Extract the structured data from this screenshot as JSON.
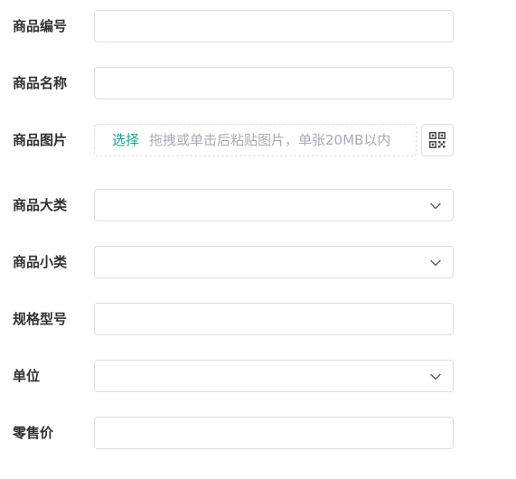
{
  "form": {
    "fields": [
      {
        "label": "商品编号",
        "type": "text",
        "value": ""
      },
      {
        "label": "商品名称",
        "type": "text",
        "value": ""
      },
      {
        "label": "商品图片",
        "type": "upload",
        "choose_label": "选择",
        "hint": "拖拽或单击后粘贴图片，单张20MB以内",
        "side_button_icon": "qr-code-icon"
      },
      {
        "label": "商品大类",
        "type": "select",
        "value": "",
        "icon": "chevron-down-icon"
      },
      {
        "label": "商品小类",
        "type": "select",
        "value": "",
        "icon": "chevron-down-icon"
      },
      {
        "label": "规格型号",
        "type": "text",
        "value": ""
      },
      {
        "label": "单位",
        "type": "select",
        "value": "",
        "icon": "chevron-down-icon"
      },
      {
        "label": "零售价",
        "type": "text",
        "value": ""
      }
    ]
  },
  "colors": {
    "label": "#303133",
    "border": "#dcdfe6",
    "accent": "#13a98b",
    "placeholder": "#a8abb2"
  }
}
